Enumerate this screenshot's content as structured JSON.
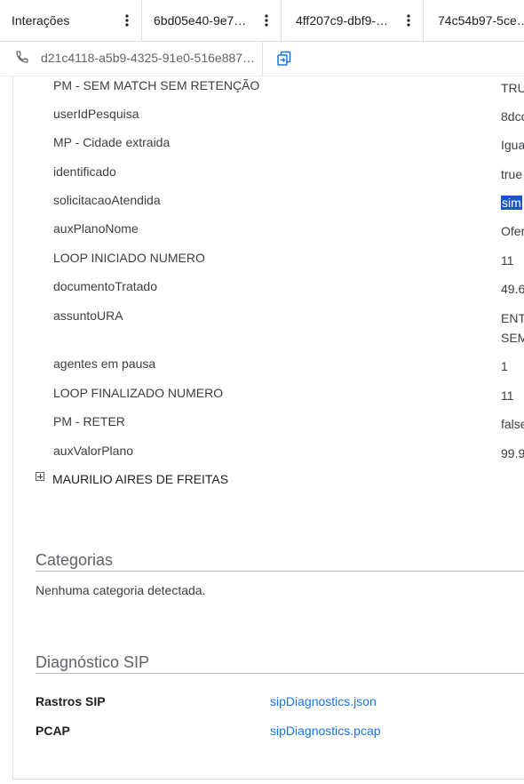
{
  "tabs": [
    {
      "label": "Interações"
    },
    {
      "label": "6bd05e40-9e7…"
    },
    {
      "label": "4ff207c9-dbf9-…"
    },
    {
      "label": "74c54b97-5ce…"
    }
  ],
  "call": {
    "id": "d21c4118-a5b9-4325-91e0-516e887…"
  },
  "attributes": [
    {
      "key": "PM - SEM MATCH SEM RETENÇÃO",
      "value": "TRU"
    },
    {
      "key": "userIdPesquisa",
      "value": "8dcc"
    },
    {
      "key": "MP - Cidade extraida",
      "value": "Igua"
    },
    {
      "key": "identificado",
      "value": "true"
    },
    {
      "key": "solicitacaoAtendida",
      "value": "sim"
    },
    {
      "key": "auxPlanoNome",
      "value": "Ofer"
    },
    {
      "key": "LOOP INICIADO NUMERO",
      "value": "11"
    },
    {
      "key": "documentoTratado",
      "value": "49.6"
    },
    {
      "key": "assuntoURA",
      "value": "ENT",
      "value2": "SEM"
    },
    {
      "key": "agentes em pausa",
      "value": "1"
    },
    {
      "key": "LOOP FINALIZADO NUMERO",
      "value": "11"
    },
    {
      "key": "PM - RETER",
      "value": "false"
    },
    {
      "key": "auxValorPlano",
      "value": "99.9"
    }
  ],
  "agent": {
    "name": "MAURILIO AIRES DE FREITAS"
  },
  "categories": {
    "title": "Categorias",
    "empty": "Nenhuma categoria detectada."
  },
  "sip": {
    "title": "Diagnóstico SIP",
    "rows": [
      {
        "label": "Rastros SIP",
        "link": "sipDiagnostics.json"
      },
      {
        "label": "PCAP",
        "link": "sipDiagnostics.pcap"
      }
    ]
  },
  "icons": {
    "menu": "more-vert-icon",
    "phone": "phone-icon",
    "copy": "copy-icon",
    "expand": "plus-box-icon"
  },
  "colors": {
    "link": "#1a73e8",
    "selection": "#1a56c9",
    "text": "#3c4043",
    "muted": "#5f6368"
  }
}
